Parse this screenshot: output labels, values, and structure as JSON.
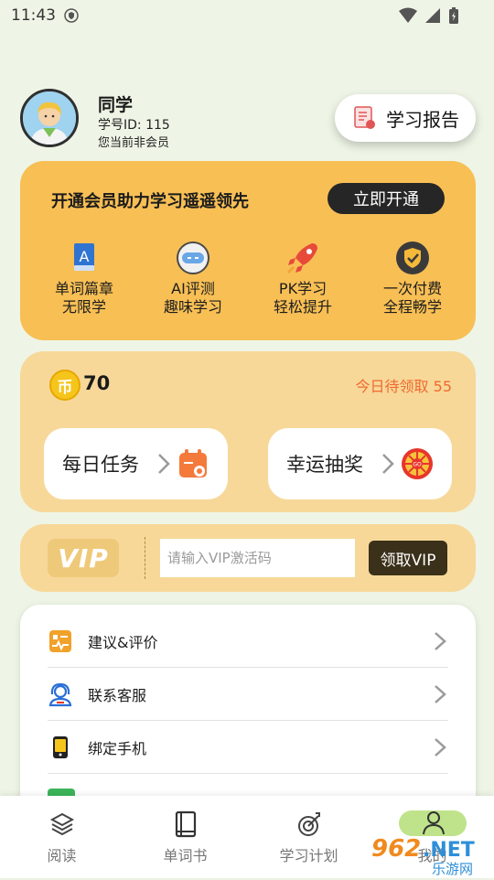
{
  "status_bar": {
    "time": "11:43"
  },
  "profile": {
    "name": "同学",
    "id_text": "学号ID: 115",
    "member_status": "您当前非会员",
    "report_button": "学习报告"
  },
  "membership": {
    "title": "开通会员助力学习遥遥领先",
    "open_button": "立即开通",
    "benefits": [
      {
        "icon": "book-icon",
        "line1": "单词篇章",
        "line2": "无限学"
      },
      {
        "icon": "robot-icon",
        "line1": "AI评测",
        "line2": "趣味学习"
      },
      {
        "icon": "rocket-icon",
        "line1": "PK学习",
        "line2": "轻松提升"
      },
      {
        "icon": "shield-check-icon",
        "line1": "一次付费",
        "line2": "全程畅学"
      }
    ]
  },
  "coins": {
    "icon_text": "币",
    "count": "70",
    "pending_text": "今日待领取 55",
    "daily_task": "每日任务",
    "lucky_draw": "幸运抽奖"
  },
  "vip": {
    "logo_text": "VIP",
    "input_placeholder": "请输入VIP激活码",
    "claim_button": "领取VIP"
  },
  "settings": {
    "items": [
      {
        "label": "建议&评价",
        "icon": "feedback-icon"
      },
      {
        "label": "联系客服",
        "icon": "customer-service-icon"
      },
      {
        "label": "绑定手机",
        "icon": "phone-icon"
      }
    ]
  },
  "bottom_nav": {
    "items": [
      {
        "label": "阅读",
        "icon": "layers-icon"
      },
      {
        "label": "单词书",
        "icon": "notebook-icon"
      },
      {
        "label": "学习计划",
        "icon": "target-icon"
      },
      {
        "label": "我的",
        "icon": "person-icon"
      }
    ]
  },
  "watermark": {
    "text": "962.NET",
    "subtext": "乐游网"
  },
  "colors": {
    "background": "#eef5e6",
    "member_card": "#f8bf55",
    "coin_card": "#f7d899",
    "accent_orange": "#ef6a2e",
    "dark_button": "#262626"
  }
}
